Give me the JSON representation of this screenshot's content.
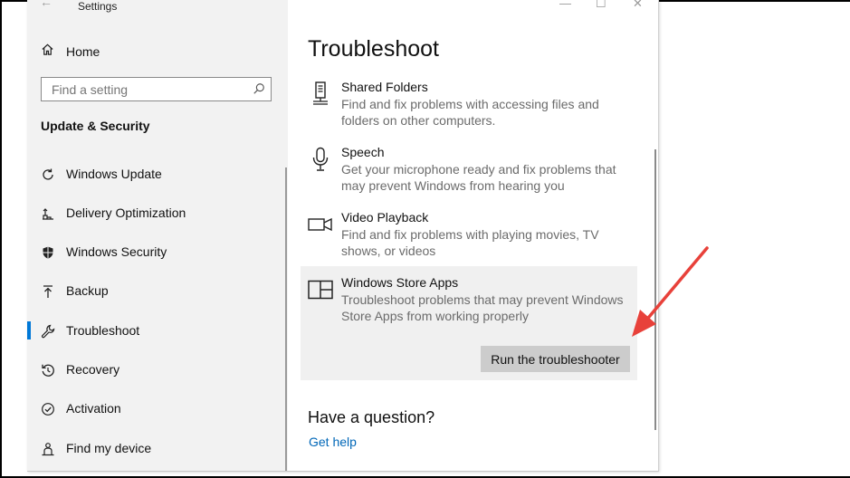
{
  "window": {
    "title": "Settings",
    "back_glyph": "←",
    "minimize_glyph": "—",
    "maximize_glyph": "☐",
    "close_glyph": "✕"
  },
  "sidebar": {
    "home_label": "Home",
    "search_placeholder": "Find a setting",
    "section_title": "Update & Security",
    "items": [
      {
        "label": "Windows Update",
        "icon": "refresh-icon"
      },
      {
        "label": "Delivery Optimization",
        "icon": "delivery-optimization-icon"
      },
      {
        "label": "Windows Security",
        "icon": "shield-icon"
      },
      {
        "label": "Backup",
        "icon": "backup-arrow-icon"
      },
      {
        "label": "Troubleshoot",
        "icon": "wrench-icon",
        "selected": true
      },
      {
        "label": "Recovery",
        "icon": "recovery-icon"
      },
      {
        "label": "Activation",
        "icon": "check-circle-icon"
      },
      {
        "label": "Find my device",
        "icon": "person-locate-icon"
      }
    ]
  },
  "main": {
    "title": "Troubleshoot",
    "troubleshooters": [
      {
        "name": "Shared Folders",
        "description": "Find and fix problems with accessing files and folders on other computers.",
        "icon": "shared-folders-icon"
      },
      {
        "name": "Speech",
        "description": "Get your microphone ready and fix problems that may prevent Windows from hearing you",
        "icon": "microphone-icon"
      },
      {
        "name": "Video Playback",
        "description": "Find and fix problems with playing movies, TV shows, or videos",
        "icon": "video-camera-icon"
      },
      {
        "name": "Windows Store Apps",
        "description": "Troubleshoot problems that may prevent Windows Store Apps from working properly",
        "icon": "store-apps-icon",
        "selected": true
      }
    ],
    "run_button_label": "Run the troubleshooter",
    "question_heading": "Have a question?",
    "help_link": "Get help"
  },
  "colors": {
    "accent": "#0078d7",
    "link": "#0067b8",
    "annotation_arrow": "#e8413a"
  }
}
